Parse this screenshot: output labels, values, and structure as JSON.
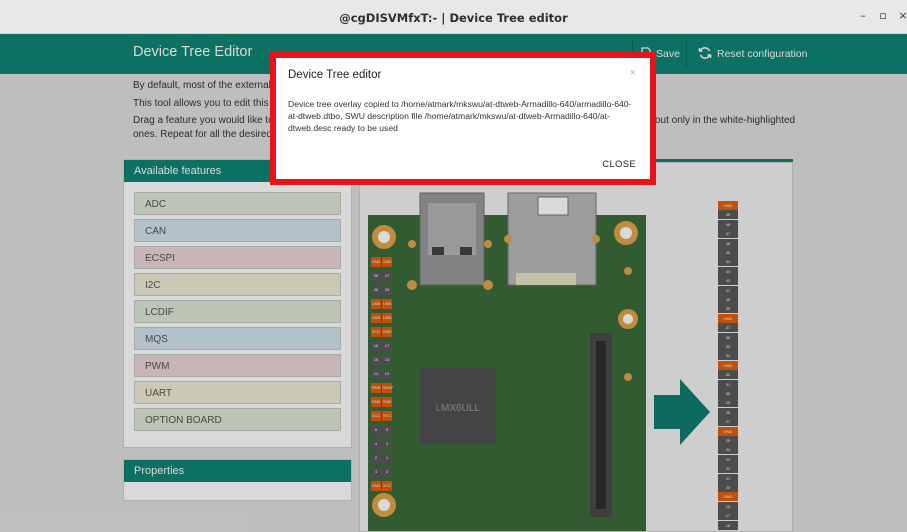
{
  "window": {
    "title": "@cgDISVMfxT:- | Device Tree editor",
    "minimize": "–",
    "maximize": "▫",
    "close": "×"
  },
  "header": {
    "title": "Device Tree Editor",
    "save_label": "Save",
    "reset_label": "Reset configuration"
  },
  "intro": {
    "line1": "By default, most of the external pi",
    "line2": "This tool allows you to edit this con",
    "line3a": "Drag a feature you would like to ex",
    "line3b": "out only in the white-highlighted",
    "line4": "ones. Repeat for all the desired fe"
  },
  "features_panel": {
    "title": "Available features",
    "items": [
      {
        "label": "ADC",
        "color": "#dfe8d4"
      },
      {
        "label": "CAN",
        "color": "#d3e4ec"
      },
      {
        "label": "ECSPI",
        "color": "#ecd6d6"
      },
      {
        "label": "I2C",
        "color": "#f0ecd6"
      },
      {
        "label": "LCDIF",
        "color": "#dfe8d4"
      },
      {
        "label": "MQS",
        "color": "#d3e4ec"
      },
      {
        "label": "PWM",
        "color": "#ecd6d6"
      },
      {
        "label": "UART",
        "color": "#f0ecd6"
      },
      {
        "label": "OPTION BOARD",
        "color": "#dfe8d4"
      }
    ]
  },
  "properties_panel": {
    "title": "Properties"
  },
  "board": {
    "chip_label": "i.MX6ULL",
    "left_pins": [
      "GND",
      "GND",
      "28",
      "27",
      "26",
      "25",
      "USB",
      "USB",
      "USB",
      "USB",
      "VCC",
      "GND",
      "18",
      "17",
      "16",
      "15",
      "14",
      "13",
      "PWR",
      "ONOF",
      "GND",
      "GND",
      "VCC",
      "VCC",
      "6",
      "5",
      "4",
      "3",
      "2",
      "1",
      "4",
      "3",
      "GND",
      "VCC"
    ],
    "right_pins": [
      "GND",
      "49",
      "48",
      "47",
      "46",
      "45",
      "44",
      "43",
      "42",
      "41",
      "40",
      "39",
      "GND",
      "37",
      "36",
      "35",
      "34",
      "GND",
      "32",
      "31",
      "30",
      "29",
      "28",
      "27",
      "GND",
      "25",
      "24",
      "23",
      "22",
      "21",
      "20",
      "GND",
      "18",
      "17",
      "16"
    ]
  },
  "modal": {
    "title": "Device Tree editor",
    "close_x": "×",
    "message": "Device tree overlay copied to /home/atmark/mkswu/at-dtweb-Armadillo-640/armadillo-640-at-dtweb.dtbo, SWU description file /home/atmark/mkswu/at-dtweb-Armadillo-640/at-dtweb.desc ready to be used",
    "button": "CLOSE"
  },
  "colors": {
    "accent": "#0f8475",
    "highlight": "#e8141b",
    "board": "#3d6b3a",
    "pin_orange": "#e35f0c"
  }
}
